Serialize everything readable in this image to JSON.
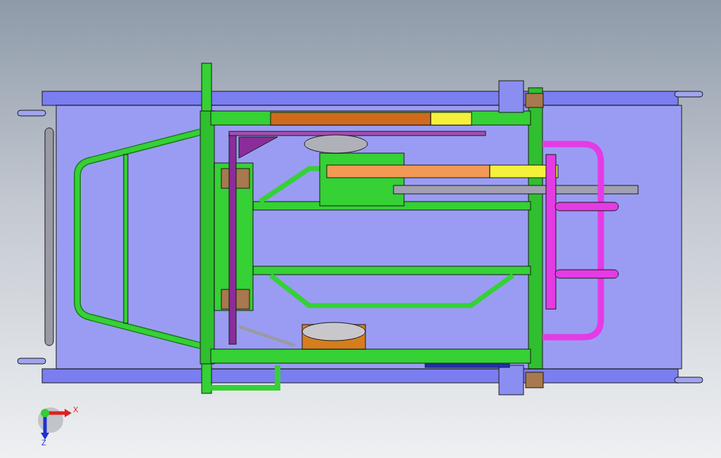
{
  "viewport": {
    "triad": {
      "x_label": "X",
      "z_label": "Z"
    }
  }
}
